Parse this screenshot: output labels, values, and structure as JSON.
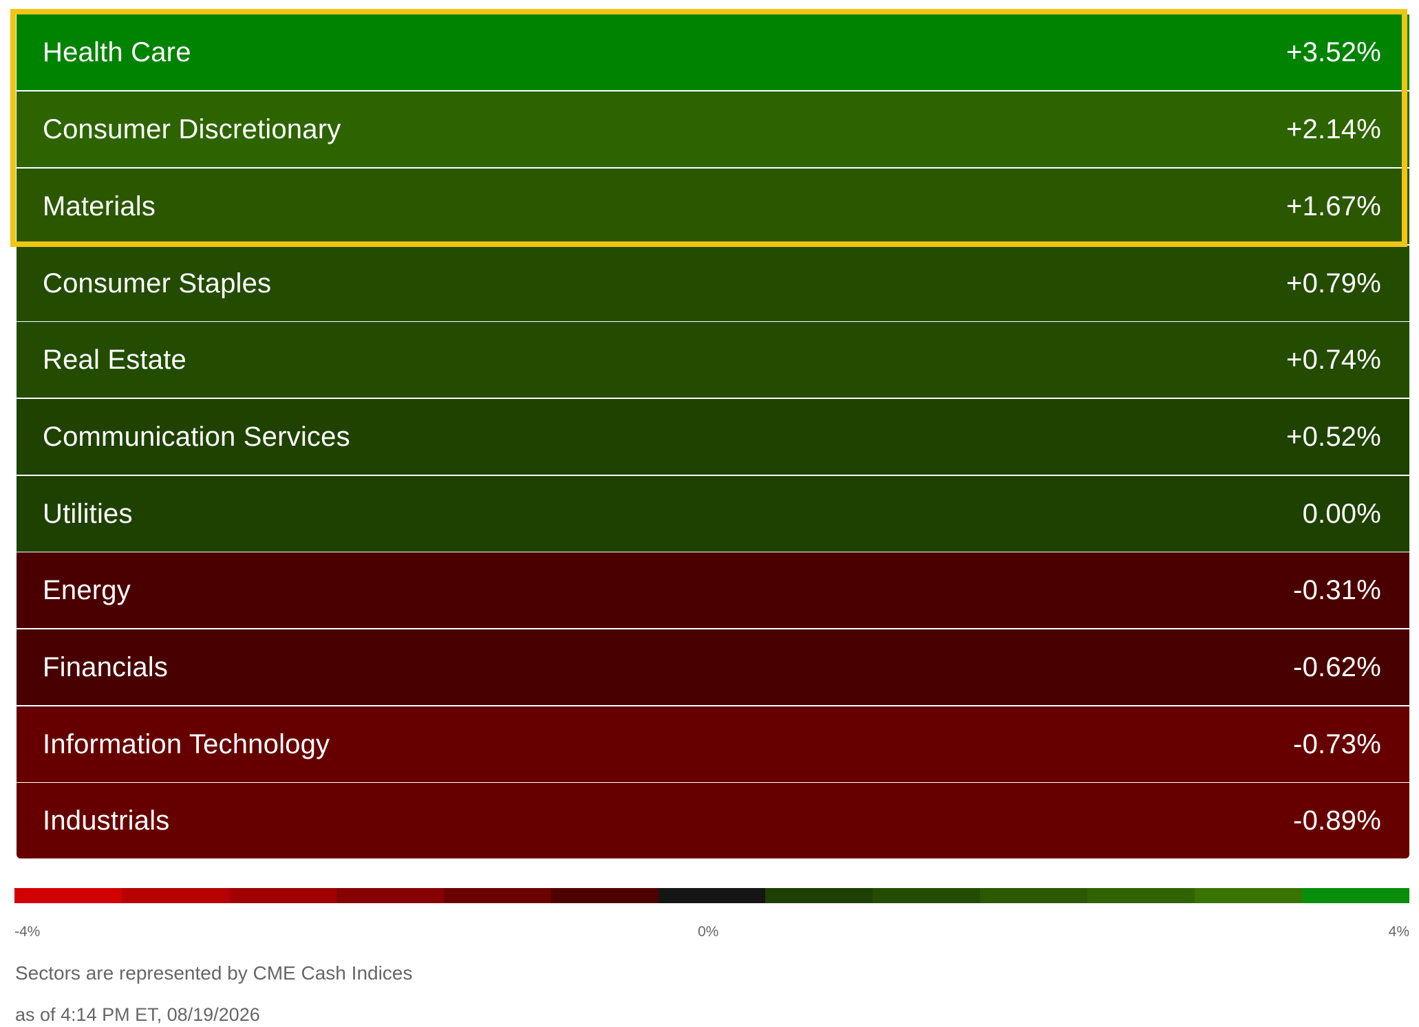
{
  "sectors": [
    {
      "name": "Health Care",
      "change": "+3.52%",
      "color": "#008300"
    },
    {
      "name": "Consumer Discretionary",
      "change": "+2.14%",
      "color": "#2d6400"
    },
    {
      "name": "Materials",
      "change": "+1.67%",
      "color": "#2b5700"
    },
    {
      "name": "Consumer Staples",
      "change": "+0.79%",
      "color": "#234c01"
    },
    {
      "name": "Real Estate",
      "change": "+0.74%",
      "color": "#234c01"
    },
    {
      "name": "Communication Services",
      "change": "+0.52%",
      "color": "#1f4200"
    },
    {
      "name": "Utilities",
      "change": "0.00%",
      "color": "#1e4000"
    },
    {
      "name": "Energy",
      "change": "-0.31%",
      "color": "#4b0000"
    },
    {
      "name": "Financials",
      "change": "-0.62%",
      "color": "#490000"
    },
    {
      "name": "Information Technology",
      "change": "-0.73%",
      "color": "#660000"
    },
    {
      "name": "Industrials",
      "change": "-0.89%",
      "color": "#660000"
    }
  ],
  "highlight": {
    "color": "#f0c516",
    "sectors": [
      "Health Care",
      "Consumer Discretionary",
      "Materials"
    ]
  },
  "legend": {
    "min_label": "-4%",
    "mid_label": "0%",
    "max_label": "4%",
    "colors": [
      "#d20000",
      "#b80000",
      "#a00000",
      "#860000",
      "#6a0000",
      "#4e0000",
      "#151515",
      "#1e4000",
      "#234c00",
      "#2b5800",
      "#306400",
      "#377400",
      "#088e0a"
    ]
  },
  "footer": {
    "source_note": "Sectors are represented by CME Cash Indices",
    "timestamp": "as of 4:14 PM ET, 08/19/2026"
  }
}
